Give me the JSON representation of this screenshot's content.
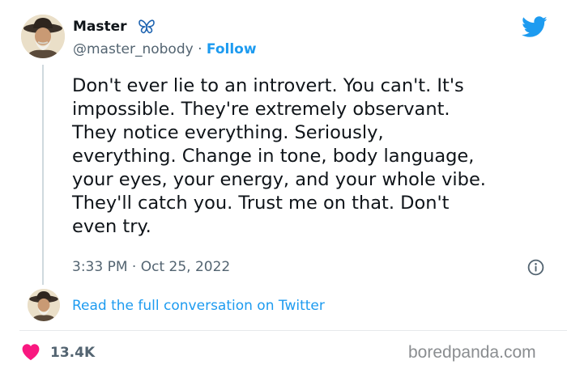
{
  "author": {
    "display_name": "Master",
    "handle": "@master_nobody",
    "separator": "·",
    "follow_label": "Follow"
  },
  "tweet": {
    "text": "Don't ever lie to an introvert. You can't. It's\nimpossible. They're extremely observant.\nThey notice everything. Seriously,\neverything. Change in tone, body language,\nyour eyes, your energy, and your whole vibe.\nThey'll catch you. Trust me on that. Don't\neven try.",
    "time": "3:33 PM",
    "separator": "·",
    "date": "Oct 25, 2022"
  },
  "conversation_link": "Read the full conversation on Twitter",
  "engagement": {
    "likes": "13.4K"
  },
  "watermark": "boredpanda.com",
  "icons": {
    "avatar": "cowboy-portrait-icon",
    "verified_badge": "butterfly-icon",
    "brand": "twitter-bird-icon",
    "info": "info-icon",
    "like": "heart-icon"
  },
  "colors": {
    "accent": "#1d9bf0",
    "text": "#0f1419",
    "muted": "#536471",
    "like": "#f91880",
    "watermark": "#8a8d90"
  }
}
